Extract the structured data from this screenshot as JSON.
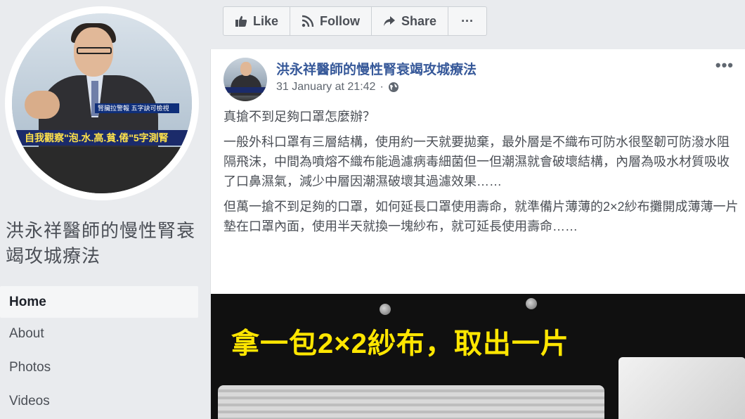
{
  "page": {
    "name": "洪永祥醫師的慢性腎衰竭攻城療法",
    "avatar_caption": "自我觀察\"泡.水.高.貧.倦\"5字測腎",
    "avatar_subcaption": "腎臟拉警報 五字訣可檢視"
  },
  "nav": {
    "items": [
      {
        "label": "Home",
        "active": true
      },
      {
        "label": "About",
        "active": false
      },
      {
        "label": "Photos",
        "active": false
      },
      {
        "label": "Videos",
        "active": false
      }
    ]
  },
  "actions": {
    "like_label": "Like",
    "follow_label": "Follow",
    "share_label": "Share",
    "more_label": "···"
  },
  "post": {
    "author": "洪永祥醫師的慢性腎衰竭攻城療法",
    "timestamp": "31 January at 21:42",
    "more_label": "•••",
    "paragraphs": [
      "真搶不到足夠口罩怎麼辦？",
      "一般外科口罩有三層結構，使用約一天就要拋棄，最外層是不織布可防水很堅韌可防潑水阻隔飛沫，中間為噴熔不織布能過濾病毒細菌但一但潮濕就會破壞結構，內層為吸水材質吸收了口鼻濕氣，減少中層因潮濕破壞其過濾效果……",
      "但萬一搶不到足夠的口罩，如何延長口罩使用壽命，就準備片薄薄的2×2紗布攤開成薄薄一片墊在口罩內面，使用半天就換一塊紗布，就可延長使用壽命……"
    ],
    "image_caption": "拿一包2×2紗布，取出一片"
  },
  "colors": {
    "link_blue": "#365899",
    "caption_yellow": "#ffe600",
    "background": "#e9ebee"
  }
}
